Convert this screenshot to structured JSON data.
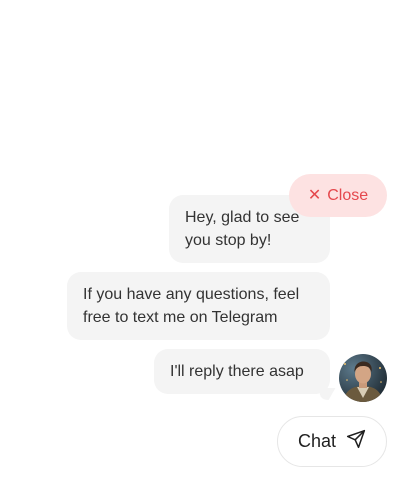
{
  "close_button": {
    "icon": "x-icon",
    "glyph": "✕",
    "label": "Close"
  },
  "messages": [
    {
      "line1": "Hey, glad to see",
      "line2": "you stop by!"
    },
    {
      "line1": "If you have any questions, feel",
      "line2": "free to text me on Telegram"
    },
    {
      "line1": "I'll reply there asap"
    }
  ],
  "avatar": {
    "description": "profile photo"
  },
  "chat_button": {
    "label": "Chat",
    "icon": "send-icon"
  },
  "colors": {
    "close_bg": "#fde2e2",
    "close_text": "#e5484d",
    "bubble_bg": "#f4f4f4",
    "text": "#333333"
  }
}
